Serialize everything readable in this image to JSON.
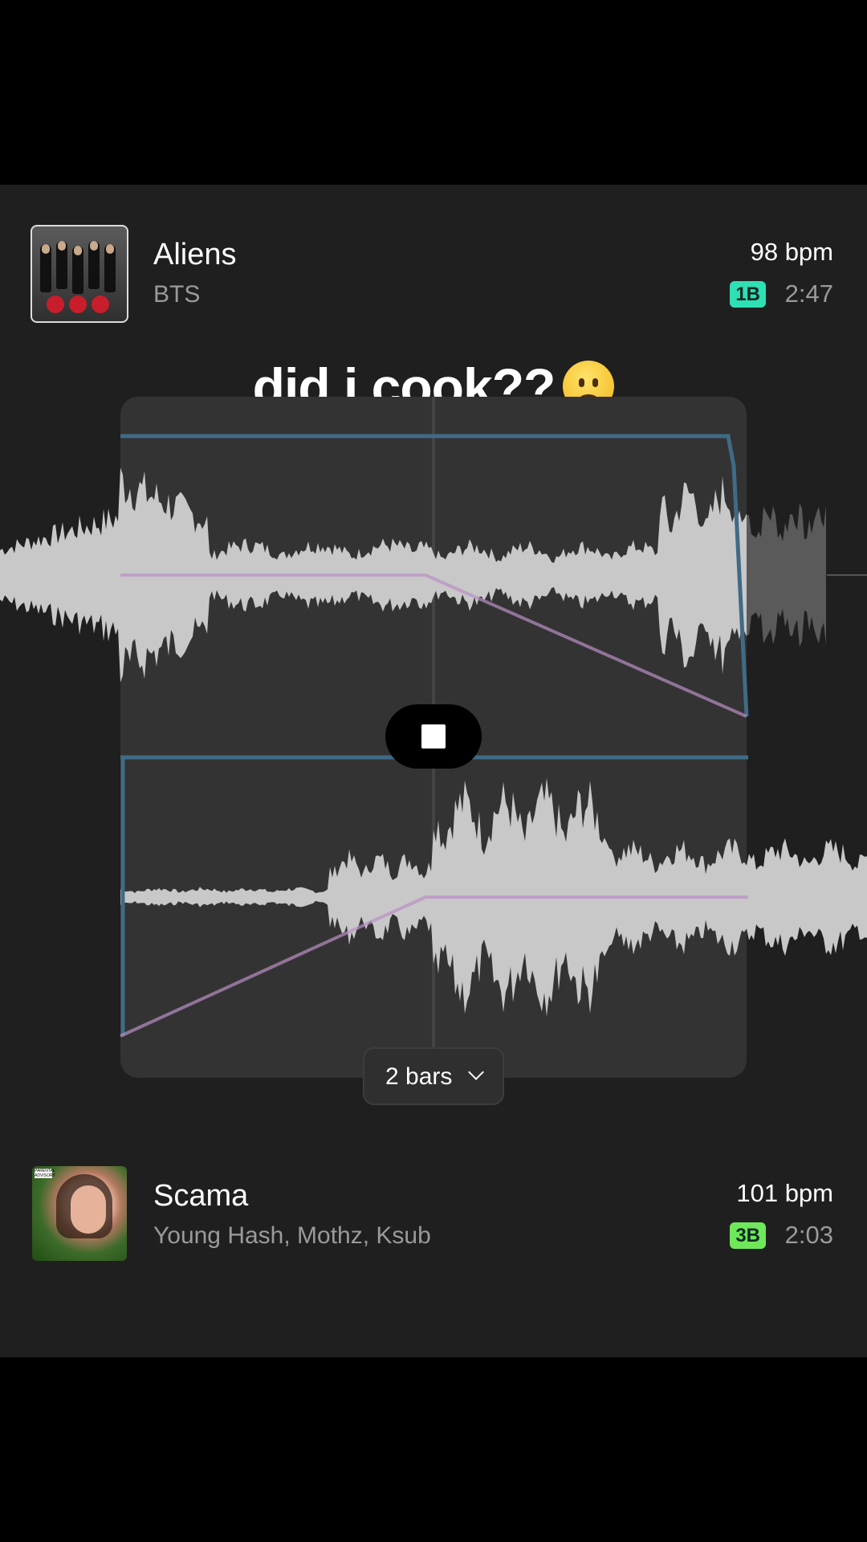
{
  "overlay": {
    "caption": "did i cook??",
    "emoji": "worried-face"
  },
  "tracks": [
    {
      "title": "Aliens",
      "artist": "BTS",
      "bpm": "98 bpm",
      "key": "1B",
      "key_color": "#2fe0b4",
      "duration": "2:47"
    },
    {
      "title": "Scama",
      "artist": "Young Hash, Mothz, Ksub",
      "bpm": "101 bpm",
      "key": "3B",
      "key_color": "#6ee85a",
      "duration": "2:03"
    }
  ],
  "controls": {
    "transition_length": "2 bars",
    "playback_state": "playing"
  },
  "colors": {
    "panel_bg": "#1f1f1f",
    "waveform": "#c8c8c8",
    "volume_automation": "#3f6b86",
    "eq_automation": "#b98fc4"
  }
}
